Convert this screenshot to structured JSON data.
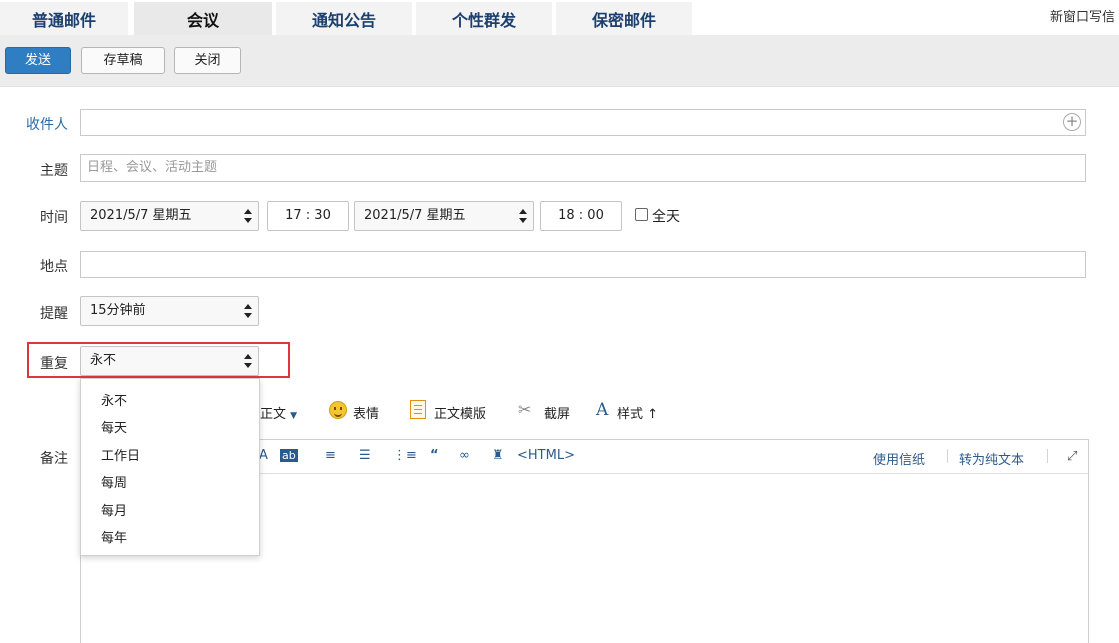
{
  "tabs": [
    "普通邮件",
    "会议",
    "通知公告",
    "个性群发",
    "保密邮件"
  ],
  "active_tab": "会议",
  "new_window_label": "新窗口写信",
  "toolbar": {
    "send": "发送",
    "save_draft": "存草稿",
    "close": "关闭"
  },
  "form": {
    "recipients_label": "收件人",
    "subject_label": "主题",
    "subject_placeholder": "日程、会议、活动主题",
    "time_label": "时间",
    "start_date": "2021/5/7 星期五",
    "start_time": "17 : 30",
    "end_date": "2021/5/7 星期五",
    "end_time": "18 : 00",
    "all_day_label": "全天",
    "location_label": "地点",
    "reminder_label": "提醒",
    "reminder_value": "15分钟前",
    "repeat_label": "重复",
    "repeat_value": "永不",
    "notes_label": "备注"
  },
  "repeat_options": [
    "永不",
    "每天",
    "工作日",
    "每周",
    "每月",
    "每年"
  ],
  "editor_tools": {
    "body_menu": "正文",
    "emoji": "表情",
    "template": "正文模版",
    "screenshot": "截屏",
    "style": "样式"
  },
  "editor_bar": {
    "html_label": "<HTML>",
    "stationery": "使用信纸",
    "plain_text": "转为纯文本"
  },
  "colors": {
    "primary": "#2f7dc3",
    "highlight": "#e0363b",
    "link": "#2a5a8e"
  }
}
